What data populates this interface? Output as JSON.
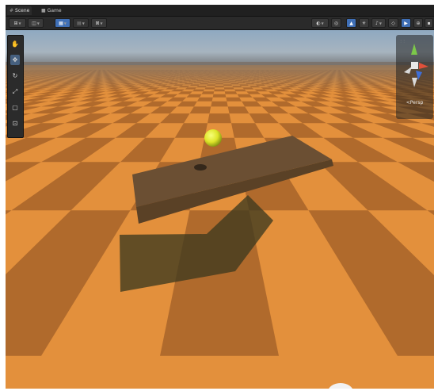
{
  "window": {
    "tabs": [
      {
        "label": "Scene",
        "icon": "scene-grid-icon",
        "active": true
      },
      {
        "label": "Game",
        "icon": "game-controller-icon",
        "active": false
      }
    ]
  },
  "toolbar": {
    "left_buttons": [
      "transform-handle-icon",
      "pivot-icon",
      "snap-icon",
      "grid-icon",
      "increment-icon"
    ],
    "right_buttons": [
      "scene-visibility-icon",
      "hidden-objects-icon",
      "render-mode-icon",
      "lighting-icon",
      "audio-icon",
      "effects-icon",
      "camera-icon",
      "gizmos-icon",
      "2d-toggle-icon"
    ]
  },
  "tools": [
    "hand-tool-icon",
    "move-tool-icon",
    "rotate-tool-icon",
    "scale-tool-icon",
    "rect-tool-icon",
    "transform-tool-icon"
  ],
  "active_tool_index": 1,
  "orientation_gizmo": {
    "label": "<Persp"
  },
  "colors": {
    "floor_light": "#e3903c",
    "floor_dark": "#b06a2c",
    "plank": "#6b4f33",
    "ball": "#e2ea2b",
    "sky_top": "#8fa9c1",
    "horizon": "#5a5a5a",
    "active_tool": "#46607f"
  }
}
